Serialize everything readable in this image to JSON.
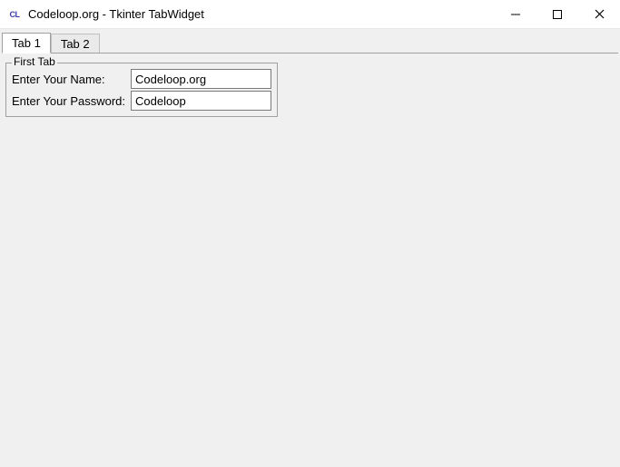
{
  "window": {
    "app_icon_text": "CL",
    "title": "Codeloop.org - Tkinter TabWidget"
  },
  "tabs": {
    "tab1_label": "Tab 1",
    "tab2_label": "Tab 2"
  },
  "form": {
    "frame_title": "First Tab",
    "name_label": "Enter Your Name:",
    "name_value": "Codeloop.org",
    "password_label": "Enter Your Password:",
    "password_value": "Codeloop"
  }
}
